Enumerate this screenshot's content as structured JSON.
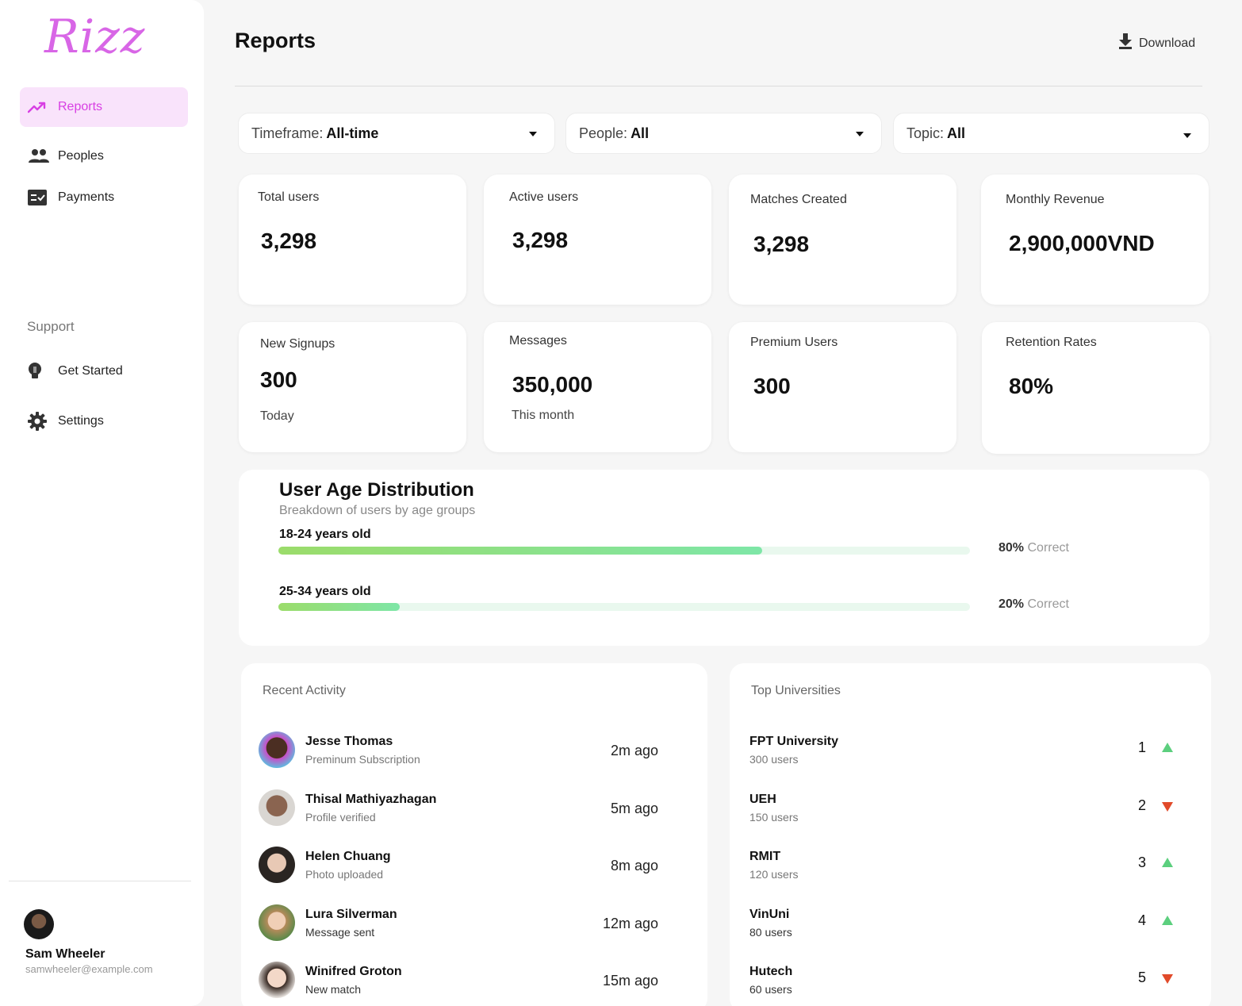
{
  "brand": {
    "logo": "Rizz",
    "accent": "#d83fe3"
  },
  "sidebar": {
    "items": [
      {
        "label": "Reports",
        "icon": "trending-up-icon",
        "active": true
      },
      {
        "label": "Peoples",
        "icon": "people-icon"
      },
      {
        "label": "Payments",
        "icon": "checklist-icon"
      }
    ],
    "support_label": "Support",
    "support_items": [
      {
        "label": "Get Started",
        "icon": "lightbulb-icon"
      },
      {
        "label": "Settings",
        "icon": "gear-icon"
      }
    ],
    "user": {
      "name": "Sam Wheeler",
      "email": "samwheeler@example.com"
    }
  },
  "header": {
    "title": "Reports",
    "download_label": "Download"
  },
  "filters": [
    {
      "label": "Timeframe:",
      "value": "All-time"
    },
    {
      "label": "People:",
      "value": "All"
    },
    {
      "label": "Topic:",
      "value": "All"
    }
  ],
  "stats": [
    {
      "label": "Total users",
      "value": "3,298"
    },
    {
      "label": "Active users",
      "value": "3,298"
    },
    {
      "label": "Matches Created",
      "value": "3,298"
    },
    {
      "label": "Monthly Revenue",
      "value": "2,900,000VND"
    },
    {
      "label": "New Signups",
      "value": "300",
      "sub": "Today"
    },
    {
      "label": "Messages",
      "value": "350,000",
      "sub": "This month"
    },
    {
      "label": "Premium Users",
      "value": "300"
    },
    {
      "label": "Retention Rates",
      "value": "80%"
    }
  ],
  "age_distribution": {
    "title": "User Age Distribution",
    "subtitle": "Breakdown of users by age groups",
    "groups": [
      {
        "label": "18-24 years old",
        "percent": 80,
        "percent_text": "80%",
        "suffix": "Correct"
      },
      {
        "label": "25-34 years old",
        "percent": 20,
        "percent_text": "20%",
        "suffix": "Correct"
      }
    ]
  },
  "recent_activity": {
    "title": "Recent Activity",
    "items": [
      {
        "name": "Jesse Thomas",
        "desc": "Preminum Subscription",
        "time": "2m ago"
      },
      {
        "name": "Thisal Mathiyazhagan",
        "desc": "Profile verified",
        "time": "5m ago"
      },
      {
        "name": "Helen Chuang",
        "desc": "Photo uploaded",
        "time": "8m ago"
      },
      {
        "name": "Lura Silverman",
        "desc": "Message sent",
        "time": "12m ago"
      },
      {
        "name": "Winifred Groton",
        "desc": "New match",
        "time": "15m ago"
      }
    ]
  },
  "top_universities": {
    "title": "Top Universities",
    "items": [
      {
        "name": "FPT University",
        "users": "300 users",
        "rank": "1",
        "trend": "up"
      },
      {
        "name": "UEH",
        "users": "150 users",
        "rank": "2",
        "trend": "down"
      },
      {
        "name": "RMIT",
        "users": "120 users",
        "rank": "3",
        "trend": "up"
      },
      {
        "name": "VinUni",
        "users": "80 users",
        "rank": "4",
        "trend": "up"
      },
      {
        "name": "Hutech",
        "users": "60 users",
        "rank": "5",
        "trend": "down"
      }
    ]
  }
}
